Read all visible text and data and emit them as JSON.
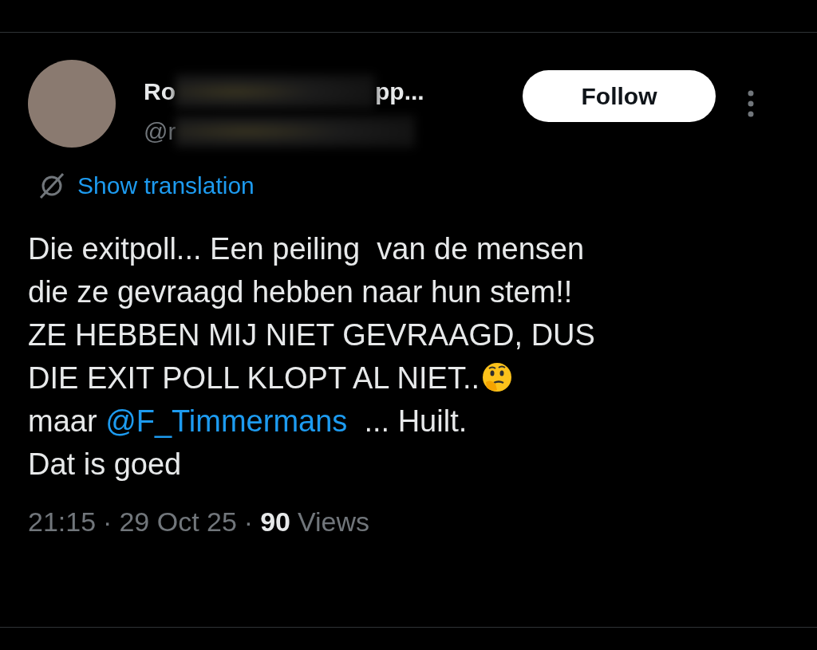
{
  "author": {
    "name_start": "Ro",
    "name_end": "pp...",
    "handle_start": "@r"
  },
  "follow_button": {
    "label": "Follow"
  },
  "translation": {
    "label": "Show translation"
  },
  "body": [
    {
      "kind": "text",
      "text": "Die exitpoll... Een peiling  van de mensen\ndie ze gevraagd hebben naar hun stem!!\nZE HEBBEN MIJ NIET GEVRAAGD, DUS\nDIE EXIT POLL KLOPT AL NIET.."
    },
    {
      "kind": "emoji"
    },
    {
      "kind": "text",
      "text": "\nmaar "
    },
    {
      "kind": "mention",
      "text": "@F_Timmermans"
    },
    {
      "kind": "text",
      "text": "  ... Huilt.\nDat is goed"
    }
  ],
  "meta": {
    "time": "21:15",
    "separator_1": "·",
    "date": "29 Oct 25",
    "separator_2": "·",
    "views_count": "90",
    "views_label": "Views"
  }
}
